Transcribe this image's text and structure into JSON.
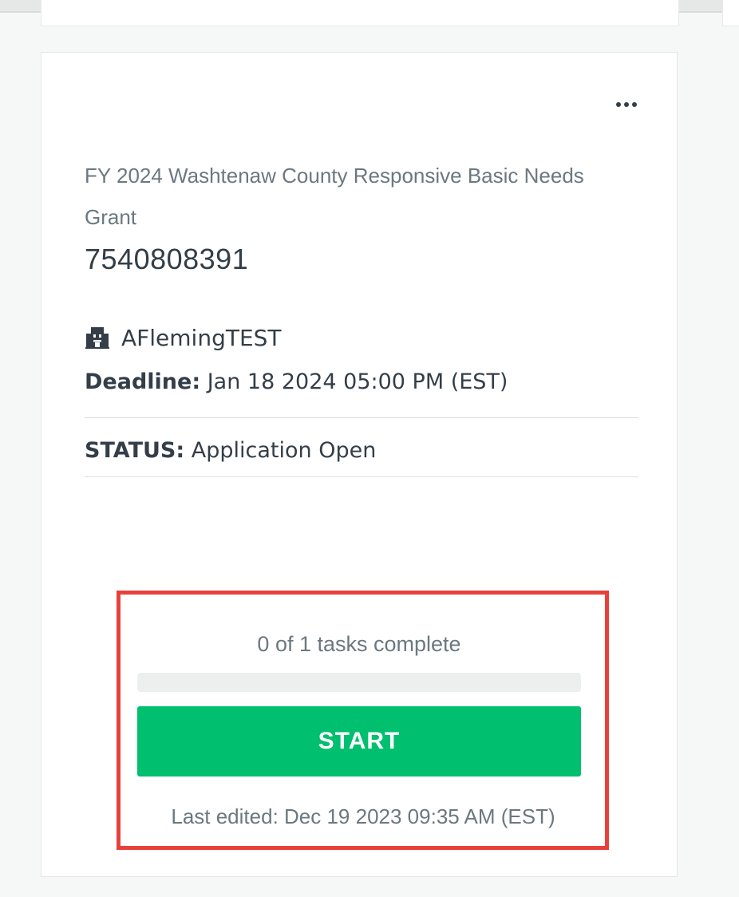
{
  "card": {
    "program_name": "FY 2024 Washtenaw County Responsive Basic Needs Grant",
    "application_number": "7540808391",
    "organization": {
      "icon": "building-icon",
      "name": "AFlemingTEST"
    },
    "deadline": {
      "label": "Deadline:",
      "value": "Jan 18 2024 05:00 PM (EST)"
    },
    "status": {
      "label": "STATUS:",
      "value": "Application Open"
    },
    "more_menu_icon": "ellipsis-icon",
    "tasks": {
      "summary": "0 of 1 tasks complete",
      "completed": 0,
      "total": 1,
      "progress_fraction": 0
    },
    "start_button_label": "START",
    "last_edited": "Last edited: Dec 19 2023 09:35 AM (EST)"
  },
  "colors": {
    "accent_green": "#00bf6f",
    "highlight_red": "#e8413c",
    "text_dark": "#333e48",
    "text_muted": "#6b787f"
  }
}
